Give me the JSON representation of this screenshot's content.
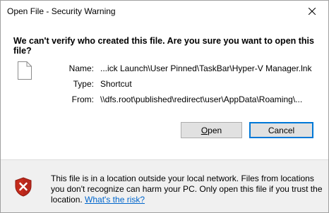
{
  "window": {
    "title": "Open File - Security Warning",
    "close_icon": "close-icon"
  },
  "heading": "We can't verify who created this file. Are you sure you want to open this file?",
  "file": {
    "icon": "file-icon",
    "name_label": "Name:",
    "name_value": "...ick Launch\\User Pinned\\TaskBar\\Hyper-V Manager.lnk",
    "type_label": "Type:",
    "type_value": "Shortcut",
    "from_label": "From:",
    "from_value": "\\\\dfs.root\\published\\redirect\\user\\AppData\\Roaming\\..."
  },
  "buttons": {
    "open_accel": "O",
    "open_rest": "pen",
    "cancel_label": "Cancel"
  },
  "warning": {
    "icon": "shield-error-icon",
    "text": "This file is in a location outside your local network. Files from locations you don't recognize can harm your PC. Only open this file if you trust the location.",
    "link_text": "What's the risk?"
  },
  "colors": {
    "link": "#0066cc",
    "focus_border": "#0078d7",
    "shield_red": "#c42b1c",
    "footer_bg": "#f0f0f0"
  }
}
